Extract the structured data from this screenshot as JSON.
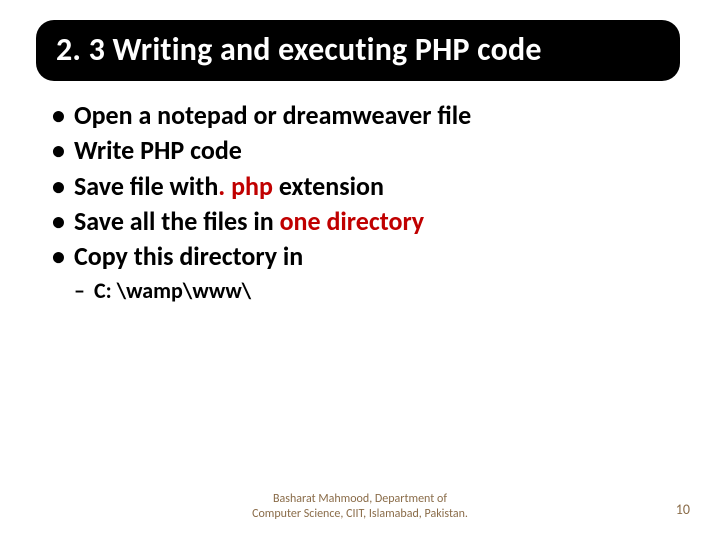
{
  "heading": "2. 3 Writing and executing  PHP code",
  "bullets": {
    "b0": "Open a notepad or dreamweaver file",
    "b1": "Write PHP code",
    "b2_a": "Save file with",
    "b2_b": ". php",
    "b2_c": " extension",
    "b3_a": "Save all the files in ",
    "b3_b": "one directory",
    "b4": "Copy this directory in"
  },
  "sub": {
    "s0": "C: \\wamp\\www\\"
  },
  "footer": {
    "line1": "Basharat Mahmood, Department of",
    "line2": "Computer Science, CIIT, Islamabad, Pakistan."
  },
  "page_number": "10",
  "colors": {
    "accent_red": "#c00000",
    "footer_color": "#8a6c49",
    "heading_bg": "#000000",
    "heading_fg": "#ffffff"
  }
}
